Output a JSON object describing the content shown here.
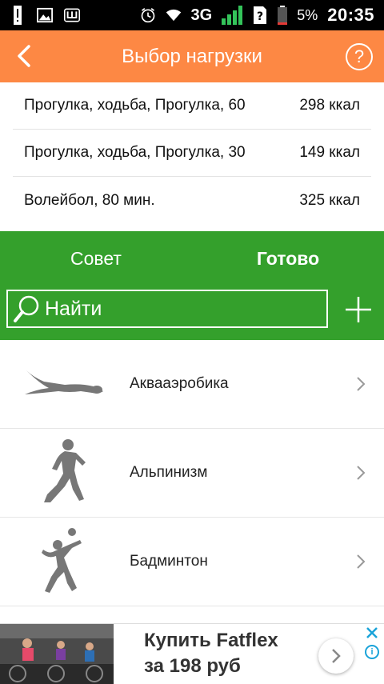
{
  "statusbar": {
    "network": "3G",
    "battery": "5%",
    "time": "20:35",
    "icons": [
      "alert-icon",
      "image-icon",
      "app-icon",
      "alarm-icon",
      "wifi-icon",
      "signal-icon",
      "sim-icon",
      "battery-icon"
    ]
  },
  "appbar": {
    "title": "Выбор нагрузки",
    "help_label": "?"
  },
  "selected": [
    {
      "name": "Прогулка, ходьба, Прогулка, 60",
      "kcal": "298 ккал"
    },
    {
      "name": "Прогулка, ходьба, Прогулка, 30",
      "kcal": "149 ккал"
    },
    {
      "name": "Волейбол, 80 мин.",
      "kcal": "325 ккал"
    }
  ],
  "tabs": {
    "advice": "Совет",
    "done": "Готово"
  },
  "search": {
    "placeholder": "Найти"
  },
  "activities": [
    {
      "label": "Аквааэробика",
      "icon": "swimmer-icon"
    },
    {
      "label": "Альпинизм",
      "icon": "runner-icon"
    },
    {
      "label": "Бадминтон",
      "icon": "badminton-icon"
    }
  ],
  "ad": {
    "line1": "Купить Fatflex",
    "line2": "за 198 руб"
  },
  "colors": {
    "appbar": "#fd8844",
    "green": "#34a02c"
  }
}
